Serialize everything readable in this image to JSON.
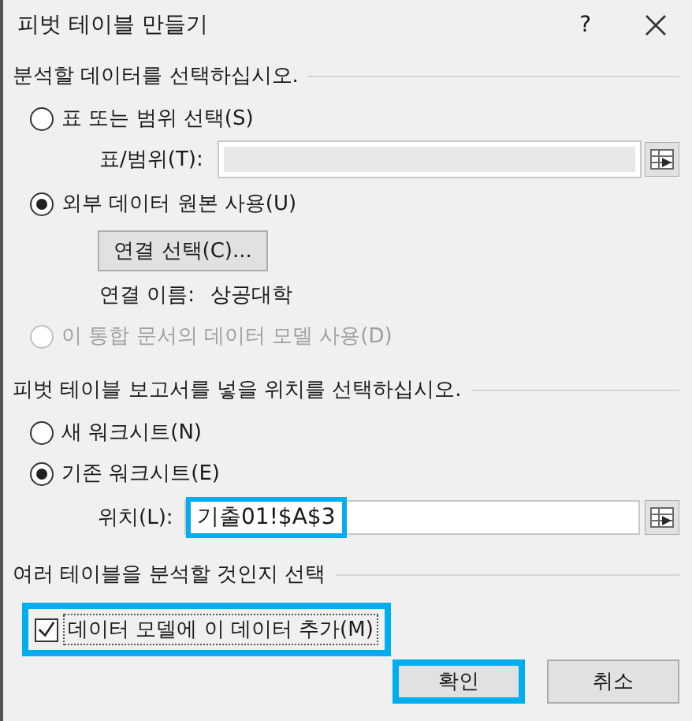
{
  "window": {
    "title": "피벗 테이블 만들기",
    "help": "?"
  },
  "source": {
    "heading": "분석할 데이터를 선택하십시오.",
    "table_option": {
      "label": "표 또는 범위 선택(S)",
      "selected": false,
      "disabled": false
    },
    "range_field": {
      "label": "표/범위(T):",
      "disabled": true
    },
    "external_option": {
      "label": "외부 데이터 원본 사용(U)",
      "selected": true,
      "disabled": false
    },
    "connection_button": "연결 선택(C)...",
    "connection_name": {
      "label": "연결 이름:",
      "value": "상공대학"
    },
    "model_option": {
      "label": "이 통합 문서의 데이터 모델 사용(D)",
      "selected": false,
      "disabled": true
    }
  },
  "destination": {
    "heading": "피벗 테이블 보고서를 넣을 위치를 선택하십시오.",
    "options": [
      {
        "label": "새 워크시트(N)",
        "selected": false
      },
      {
        "label": "기존 워크시트(E)",
        "selected": true
      }
    ],
    "location_field": {
      "label": "위치(L):",
      "value": "기출01!$A$3",
      "highlighted": true
    }
  },
  "multiple": {
    "heading": "여러 테이블을 분석할 것인지 선택",
    "checkbox": {
      "label": "데이터 모델에 이 데이터 추가(M)",
      "checked": true,
      "highlighted": true
    }
  },
  "buttons": [
    {
      "label": "확인",
      "kind": "ok",
      "highlighted": true
    },
    {
      "label": "취소",
      "kind": "cancel",
      "highlighted": false
    }
  ]
}
